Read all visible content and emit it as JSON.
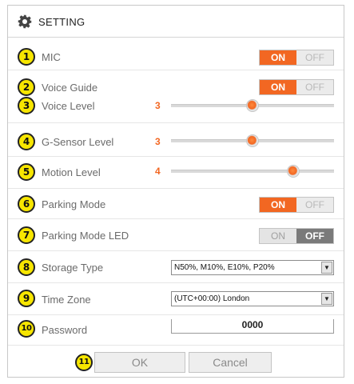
{
  "header": {
    "title": "SETTING",
    "icon": "gear-icon"
  },
  "accent_color": "#f26722",
  "settings": {
    "mic": {
      "badge": "1",
      "label": "MIC",
      "on_label": "ON",
      "off_label": "OFF",
      "state": "on"
    },
    "voice_guide": {
      "badge": "2",
      "label": "Voice Guide",
      "on_label": "ON",
      "off_label": "OFF",
      "state": "on"
    },
    "voice_level": {
      "badge": "3",
      "label": "Voice Level",
      "value": "3",
      "fraction": 0.5
    },
    "gsensor_level": {
      "badge": "4",
      "label": "G-Sensor Level",
      "value": "3",
      "fraction": 0.5
    },
    "motion_level": {
      "badge": "5",
      "label": "Motion Level",
      "value": "4",
      "fraction": 0.75
    },
    "parking_mode": {
      "badge": "6",
      "label": "Parking Mode",
      "on_label": "ON",
      "off_label": "OFF",
      "state": "on"
    },
    "parking_mode_led": {
      "badge": "7",
      "label": "Parking Mode LED",
      "on_label": "ON",
      "off_label": "OFF",
      "state": "off"
    },
    "storage_type": {
      "badge": "8",
      "label": "Storage Type",
      "value": "N50%, M10%, E10%, P20%"
    },
    "time_zone": {
      "badge": "9",
      "label": "Time Zone",
      "value": "(UTC+00:00) London"
    },
    "password": {
      "badge": "10",
      "label": "Password",
      "value": "0000"
    }
  },
  "footer": {
    "badge": "11",
    "ok_label": "OK",
    "cancel_label": "Cancel"
  }
}
